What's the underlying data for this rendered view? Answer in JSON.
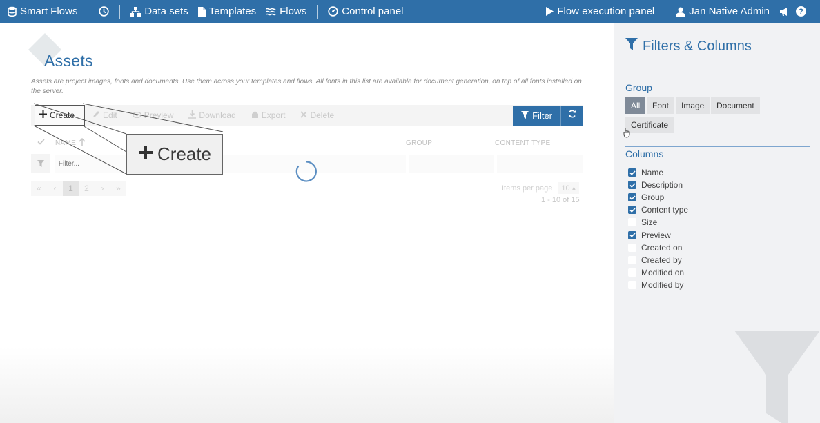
{
  "topbar": {
    "brand": "Smart Flows",
    "nav": {
      "data_sets": "Data sets",
      "templates": "Templates",
      "flows": "Flows",
      "control_panel": "Control panel"
    },
    "flow_execution": "Flow execution panel",
    "user": "Jan Native Admin",
    "help": "?"
  },
  "page": {
    "title": "Assets",
    "description": "Assets are project images, fonts and documents. Use them across your templates and flows. All fonts in this list are available for document generation, on top of all fonts installed on the server."
  },
  "toolbar": {
    "create": "Create",
    "edit": "Edit",
    "preview": "Preview",
    "download": "Download",
    "export": "Export",
    "delete": "Delete",
    "filter": "Filter"
  },
  "table": {
    "columns": {
      "name": "NAME",
      "group": "GROUP",
      "content_type": "CONTENT TYPE"
    },
    "name_filter_placeholder": "Filter..."
  },
  "pagination": {
    "first": "«",
    "prev": "‹",
    "pages": [
      "1",
      "2"
    ],
    "next": "›",
    "last": "»",
    "items_per_page_label": "Items per page",
    "items_per_page": "10",
    "range": "1 - 10 of 15"
  },
  "zoom_callout": {
    "label": "Create"
  },
  "panel": {
    "title": "Filters & Columns",
    "group_title": "Group",
    "groups": [
      {
        "label": "All",
        "active": true
      },
      {
        "label": "Font",
        "active": false
      },
      {
        "label": "Image",
        "active": false
      },
      {
        "label": "Document",
        "active": false
      },
      {
        "label": "Certificate",
        "active": false
      }
    ],
    "columns_title": "Columns",
    "columns": [
      {
        "label": "Name",
        "checked": true
      },
      {
        "label": "Description",
        "checked": true
      },
      {
        "label": "Group",
        "checked": true
      },
      {
        "label": "Content type",
        "checked": true
      },
      {
        "label": "Size",
        "checked": false
      },
      {
        "label": "Preview",
        "checked": true
      },
      {
        "label": "Created on",
        "checked": false
      },
      {
        "label": "Created by",
        "checked": false
      },
      {
        "label": "Modified on",
        "checked": false
      },
      {
        "label": "Modified by",
        "checked": false
      }
    ]
  },
  "colors": {
    "primary": "#2f6fa8",
    "panel_bg": "#f1f2f4",
    "chip_active": "#7f8a98"
  },
  "icons": [
    "database-icon",
    "clock-icon",
    "sitemap-icon",
    "file-icon",
    "waves-icon",
    "gauge-icon",
    "play-icon",
    "user-icon",
    "megaphone-icon",
    "plus-icon",
    "pencil-icon",
    "eye-icon",
    "download-icon",
    "export-icon",
    "times-icon",
    "funnel-icon",
    "refresh-icon",
    "check-icon",
    "arrow-up-icon",
    "spinner-icon"
  ]
}
